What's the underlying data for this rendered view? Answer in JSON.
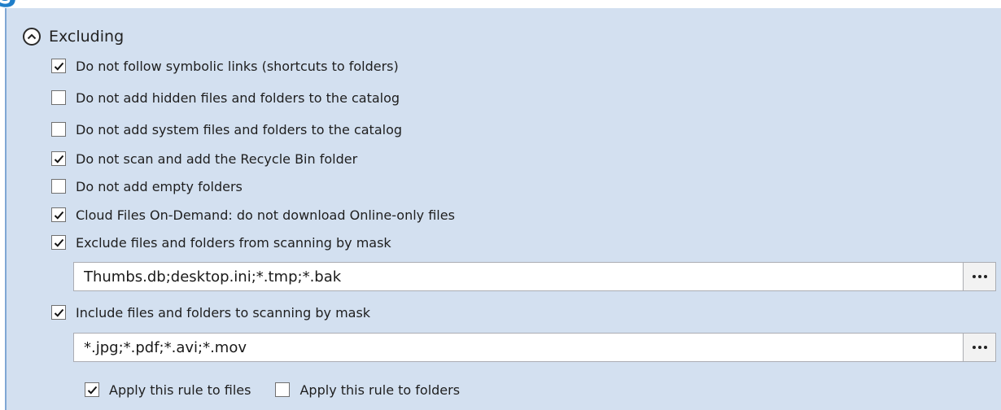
{
  "section": {
    "title": "Excluding",
    "collapse_icon": "chevron-up-circle-icon"
  },
  "options": [
    {
      "label": "Do not follow symbolic links (shortcuts to folders)",
      "checked": true
    },
    {
      "label": "Do not add hidden files and folders to the catalog",
      "checked": false
    },
    {
      "label": "Do not add system files and folders to the catalog",
      "checked": false
    },
    {
      "label": "Do not scan and add the Recycle Bin folder",
      "checked": true
    },
    {
      "label": "Do not add empty folders",
      "checked": false
    },
    {
      "label": "Cloud Files On-Demand: do not download Online-only files",
      "checked": true
    },
    {
      "label": "Exclude files and folders from scanning by mask",
      "checked": true
    }
  ],
  "exclude_mask": {
    "value": "Thumbs.db;desktop.ini;*.tmp;*.bak",
    "browse_icon": "ellipsis-icon"
  },
  "include_option": {
    "label": "Include files and folders to scanning by mask",
    "checked": true
  },
  "include_mask": {
    "value": "*.jpg;*.pdf;*.avi;*.mov",
    "browse_icon": "ellipsis-icon"
  },
  "apply": {
    "files": {
      "label": "Apply this rule to files",
      "checked": true
    },
    "folders": {
      "label": "Apply this rule to folders",
      "checked": false
    }
  },
  "colors": {
    "panel_bg": "#d3e0f0",
    "panel_border": "#7fa7d4"
  }
}
